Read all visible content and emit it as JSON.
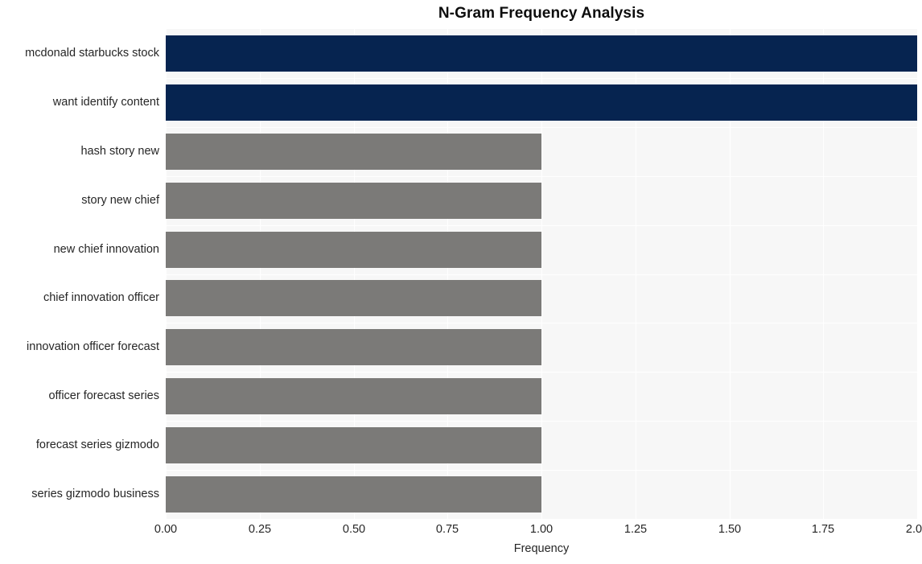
{
  "chart_data": {
    "type": "bar",
    "orientation": "horizontal",
    "title": "N-Gram Frequency Analysis",
    "xlabel": "Frequency",
    "ylabel": "",
    "xlim": [
      0,
      2.0
    ],
    "xticks": [
      "0.00",
      "0.25",
      "0.50",
      "0.75",
      "1.00",
      "1.25",
      "1.50",
      "1.75",
      "2.00"
    ],
    "xtick_values": [
      0,
      0.25,
      0.5,
      0.75,
      1.0,
      1.25,
      1.5,
      1.75,
      2.0
    ],
    "grid": true,
    "legend": null,
    "categories": [
      "mcdonald starbucks stock",
      "want identify content",
      "hash story new",
      "story new chief",
      "new chief innovation",
      "chief innovation officer",
      "innovation officer forecast",
      "officer forecast series",
      "forecast series gizmodo",
      "series gizmodo business"
    ],
    "values": [
      2,
      2,
      1,
      1,
      1,
      1,
      1,
      1,
      1,
      1
    ],
    "bar_colors": [
      "#062450",
      "#062450",
      "#7b7a78",
      "#7b7a78",
      "#7b7a78",
      "#7b7a78",
      "#7b7a78",
      "#7b7a78",
      "#7b7a78",
      "#7b7a78"
    ]
  },
  "style": {
    "figure_background": "#ffffff",
    "plot_background": "#f7f7f7",
    "grid_color": "#ffffff",
    "highlight_color": "#062450",
    "default_bar_color": "#7b7a78",
    "text_color": "#262626",
    "title_color": "#0d0d0d"
  }
}
